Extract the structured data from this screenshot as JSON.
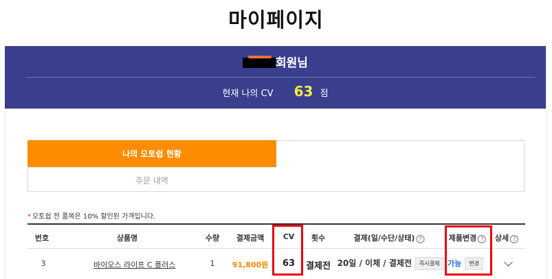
{
  "page": {
    "title": "마이페이지"
  },
  "member": {
    "name_suffix": "회원님",
    "cv_label": "현재 나의 CV",
    "cv_value": "63",
    "cv_unit": "점"
  },
  "tabs": [
    {
      "label": "나의 오토쉽 현황",
      "active": true
    },
    {
      "label": "주문 내역",
      "active": false
    }
  ],
  "notice": {
    "marker": "*",
    "text": "오토쉽 전 품목은 10% 할인된 가격입니다."
  },
  "table": {
    "headers": {
      "no": "번호",
      "product": "상품명",
      "qty": "수량",
      "amount": "결제금액",
      "cv": "CV",
      "count": "횟수",
      "payment": "결제(일/수단/상태)",
      "change": "제품변경",
      "detail": "상세"
    },
    "rows": [
      {
        "no": "3",
        "product": "바이오스 라이프 C 플러스",
        "qty": "1",
        "amount": "91,800원",
        "cv": "63",
        "count": "결제전",
        "payment": "20일 / 이체 / 결제전",
        "pay_button": "즉시결제",
        "change_status": "가능",
        "change_button": "변경"
      }
    ]
  },
  "colors": {
    "banner": "#393f8d",
    "accent_orange": "#ff8c00",
    "cv_yellow": "#f5e84b",
    "amount_orange": "#f08c00",
    "link_blue": "#1e6fd9",
    "highlight_red": "#e8000b"
  },
  "icons": {
    "help": "help-circle-icon",
    "expand": "chevron-down-icon"
  }
}
